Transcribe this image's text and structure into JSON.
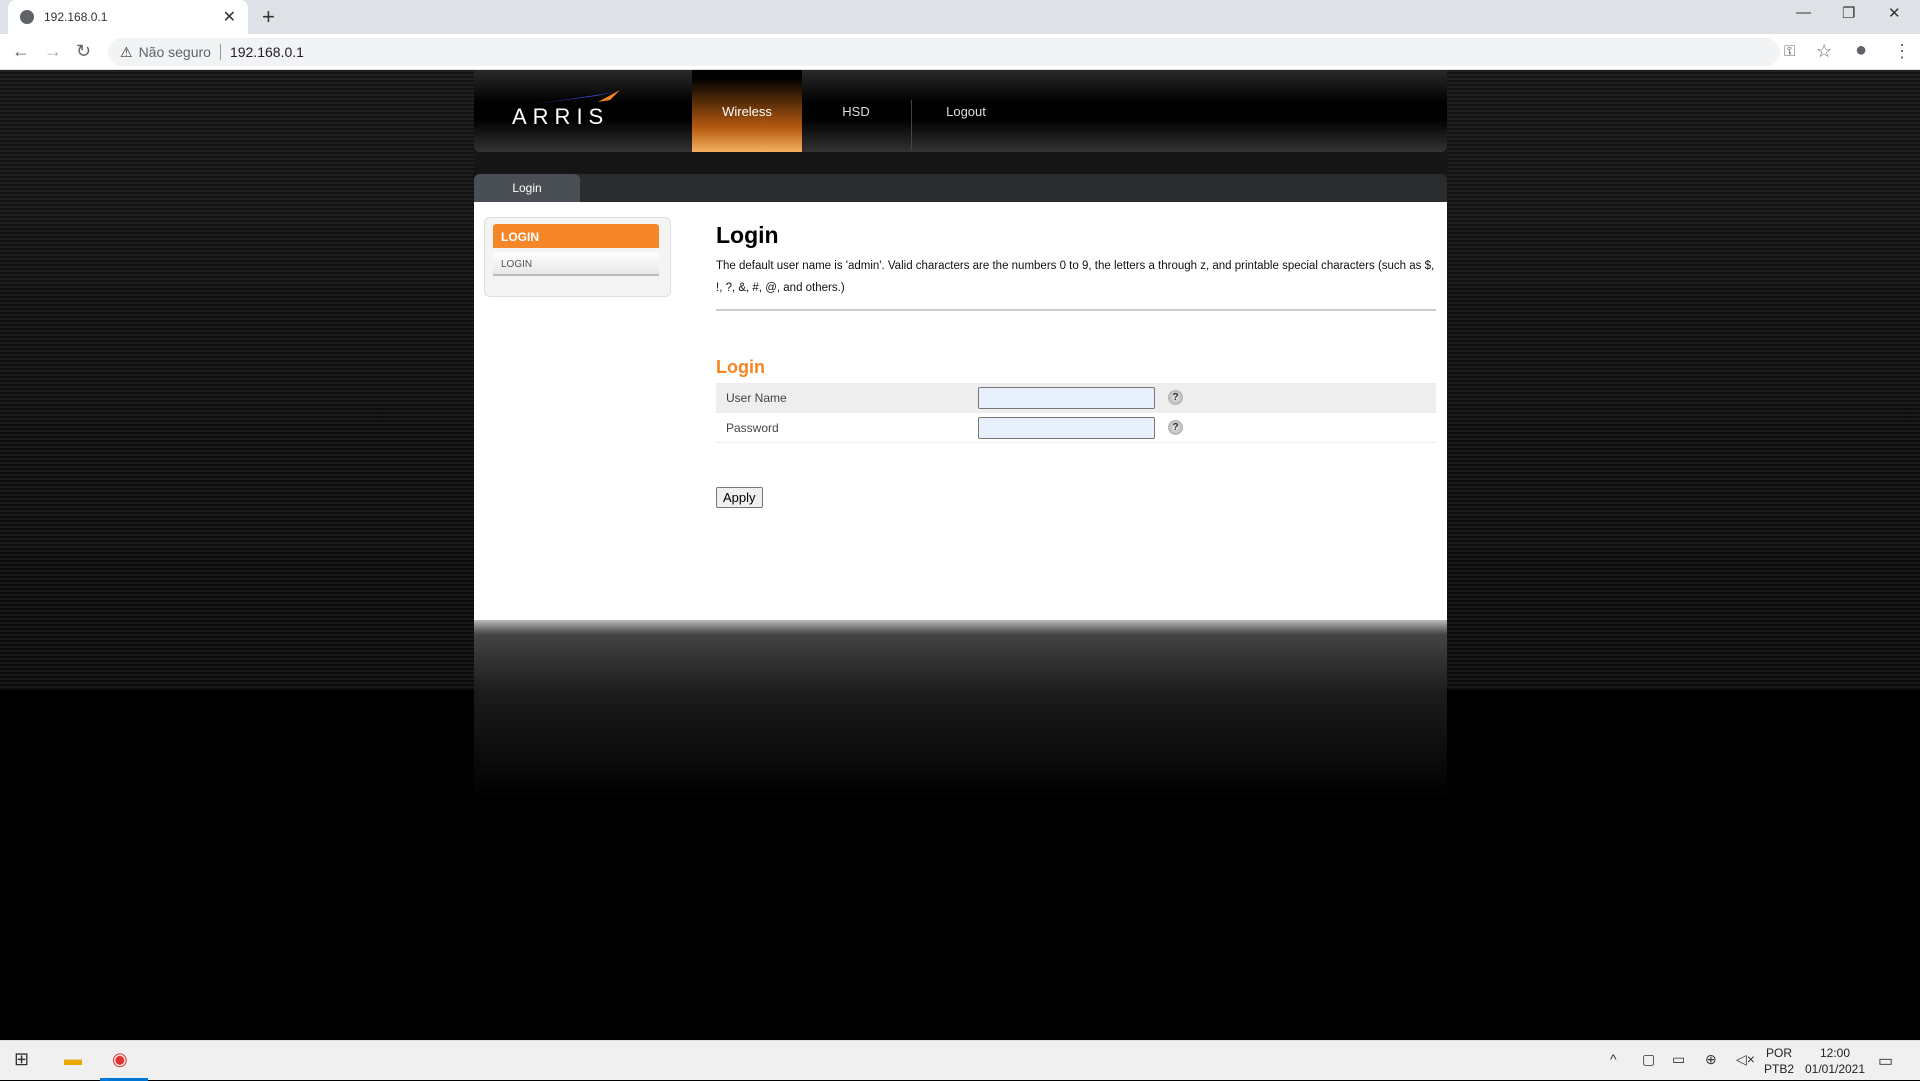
{
  "browser": {
    "tab_title": "192.168.0.1",
    "security_label": "Não seguro",
    "url": "192.168.0.1"
  },
  "header": {
    "logo": "ARRIS",
    "nav": [
      {
        "label": "Wireless",
        "active": true
      },
      {
        "label": "HSD"
      },
      {
        "label": "Logout"
      }
    ]
  },
  "subtab": "Login",
  "sidebar": {
    "header": "LOGIN",
    "items": [
      "LOGIN"
    ]
  },
  "main": {
    "title": "Login",
    "description": "The default user name is 'admin'. Valid characters are the numbers 0 to 9, the letters a through z, and printable special characters (such as $, !, ?, &, #, @, and others.)",
    "section_title": "Login",
    "fields": [
      {
        "label": "User Name",
        "value": ""
      },
      {
        "label": "Password",
        "value": ""
      }
    ],
    "help_glyph": "?",
    "apply_label": "Apply"
  },
  "taskbar": {
    "lang_top": "POR",
    "lang_bottom": "PTB2",
    "time": "12:00",
    "date": "01/01/2021"
  },
  "colors": {
    "accent": "#f5861f",
    "tab_active": "#4a4e55"
  }
}
